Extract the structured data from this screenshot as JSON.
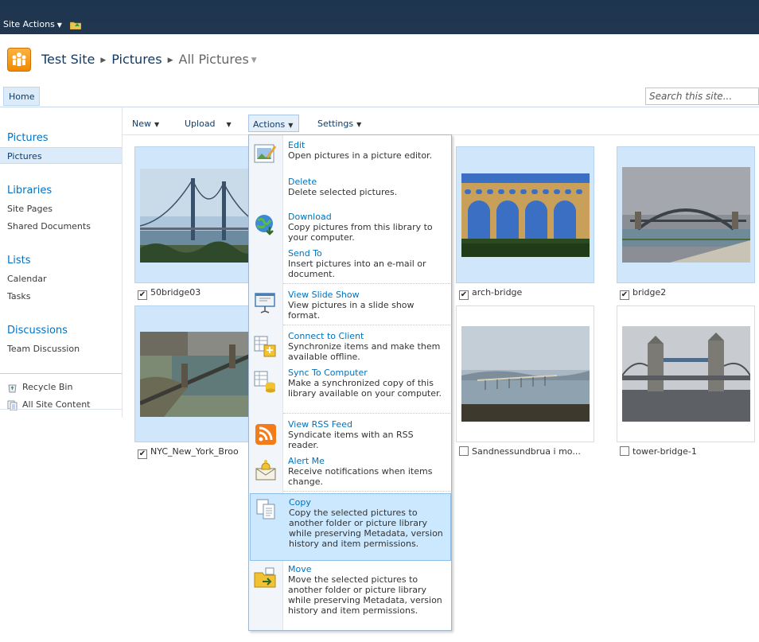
{
  "topbar": {
    "site_actions": "Site Actions"
  },
  "breadcrumb": {
    "site": "Test Site",
    "library": "Pictures",
    "view": "All Pictures"
  },
  "nav": {
    "home": "Home",
    "search_placeholder": "Search this site..."
  },
  "leftnav": {
    "pictures_header": "Pictures",
    "pictures_item": "Pictures",
    "libraries_header": "Libraries",
    "libraries": [
      "Site Pages",
      "Shared Documents"
    ],
    "lists_header": "Lists",
    "lists": [
      "Calendar",
      "Tasks"
    ],
    "discussions_header": "Discussions",
    "discussions": [
      "Team Discussion"
    ],
    "recycle_bin": "Recycle Bin",
    "all_site_content": "All Site Content"
  },
  "toolbar": {
    "new": "New",
    "upload": "Upload",
    "actions": "Actions",
    "settings": "Settings"
  },
  "pictures": [
    {
      "name": "50bridge03",
      "checked": true
    },
    {
      "name": "arch-bridge",
      "checked": true
    },
    {
      "name": "bridge2",
      "checked": true
    },
    {
      "name": "NYC_New_York_Broo",
      "checked": true
    },
    {
      "name": "Sandnessundbrua i mo...",
      "checked": false
    },
    {
      "name": "tower-bridge-1",
      "checked": false
    }
  ],
  "menu": [
    {
      "title": "Edit",
      "desc": "Open pictures in a picture editor.",
      "icon": "edit-picture-icon"
    },
    {
      "title": "Delete",
      "desc": "Delete selected pictures.",
      "icon": ""
    },
    {
      "title": "Download",
      "desc": "Copy pictures from this library to your computer.",
      "icon": "download-globe-icon"
    },
    {
      "title": "Send To",
      "desc": "Insert pictures into an e-mail or document.",
      "icon": ""
    },
    {
      "title": "View Slide Show",
      "desc": "View pictures in a slide show format.",
      "icon": "slide-show-icon"
    },
    {
      "title": "Connect to Client",
      "desc": "Synchronize items and make them available offline.",
      "icon": "connect-client-icon"
    },
    {
      "title": "Sync To Computer",
      "desc": "Make a synchronized copy of this library available on your computer.",
      "icon": "sync-computer-icon"
    },
    {
      "title": "View RSS Feed",
      "desc": "Syndicate items with an RSS reader.",
      "icon": "rss-icon"
    },
    {
      "title": "Alert Me",
      "desc": "Receive notifications when items change.",
      "icon": "alert-me-icon"
    },
    {
      "title": "Copy",
      "desc": "Copy the selected pictures to another folder or picture library while preserving Metadata, version history and item permissions.",
      "icon": "copy-icon"
    },
    {
      "title": "Move",
      "desc": "Move the selected pictures to another folder or picture library while preserving Metadata, version history and item permissions.",
      "icon": "move-folder-icon"
    }
  ],
  "colors": {
    "accent": "#0072bc",
    "topbar": "#1f3651",
    "selection": "#cce8ff"
  }
}
